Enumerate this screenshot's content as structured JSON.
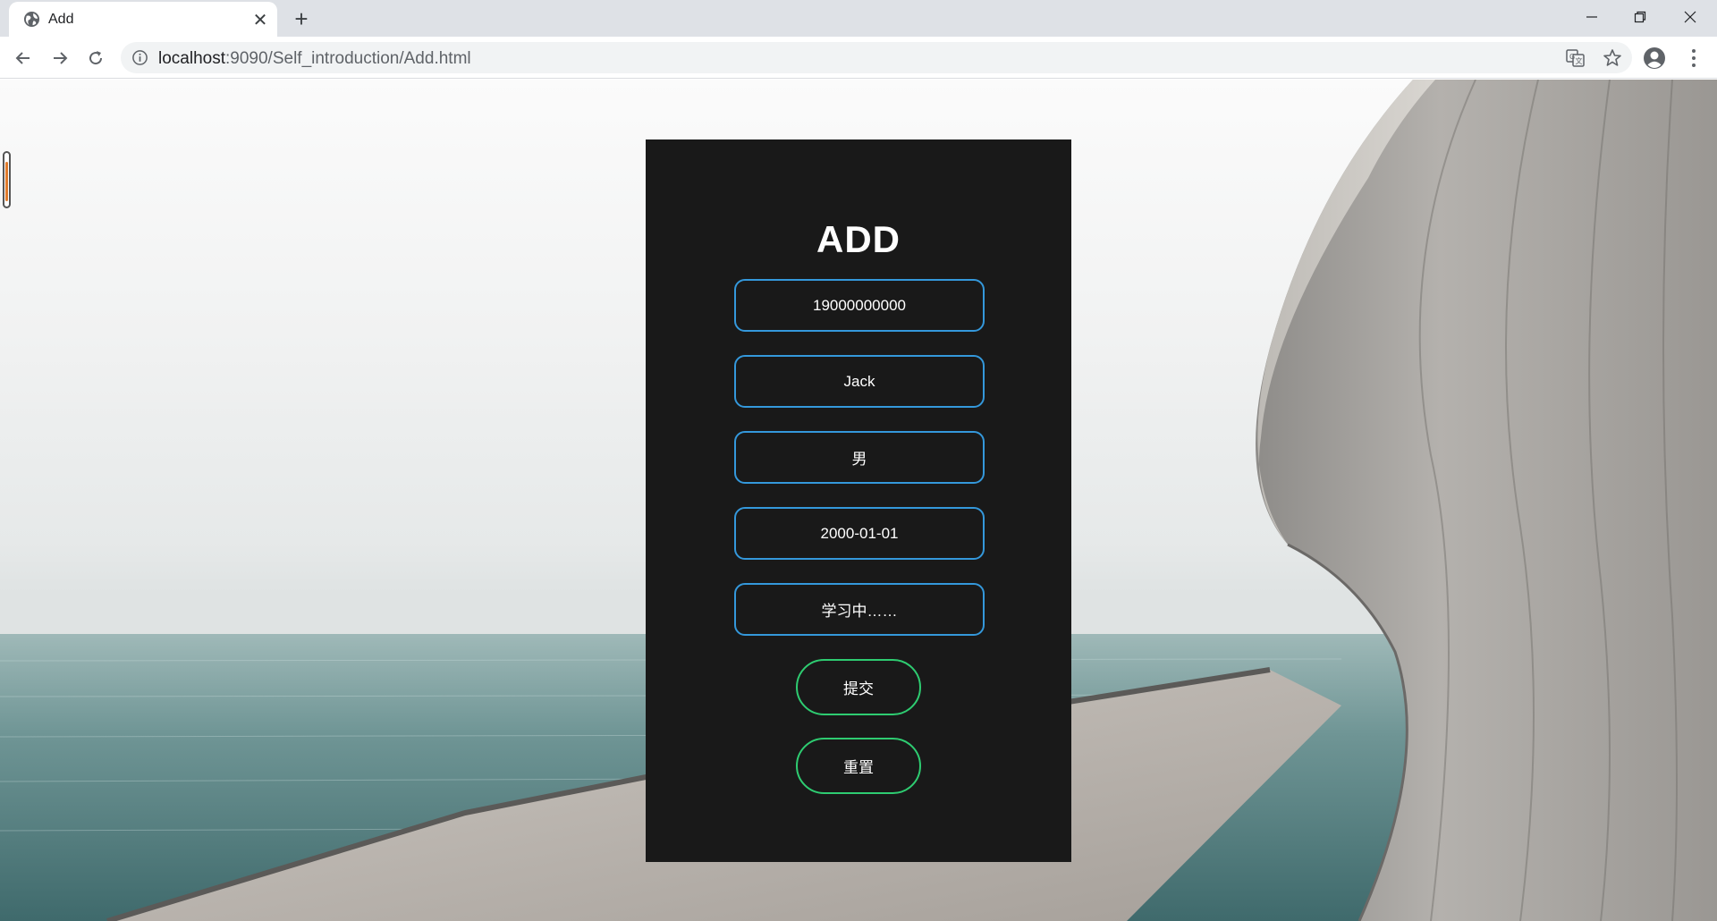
{
  "browser": {
    "tab": {
      "title": "Add",
      "close_label": "✕"
    },
    "new_tab_label": "+",
    "address": {
      "host": "localhost",
      "path": ":9090/Self_introduction/Add.html"
    }
  },
  "page": {
    "title": "ADD",
    "fields": [
      {
        "name": "phone",
        "value": "19000000000"
      },
      {
        "name": "name",
        "value": "Jack"
      },
      {
        "name": "gender",
        "value": "男"
      },
      {
        "name": "birthday",
        "value": "2000-01-01"
      },
      {
        "name": "status",
        "value": "学习中……"
      }
    ],
    "submit_label": "提交",
    "reset_label": "重置"
  },
  "colors": {
    "field_border": "#3498db",
    "button_border": "#2ecc71",
    "card_bg": "#191919"
  },
  "icons": [
    "globe-icon",
    "close-icon",
    "plus-icon",
    "back-arrow-icon",
    "forward-arrow-icon",
    "reload-icon",
    "info-icon",
    "translate-icon",
    "star-icon",
    "profile-icon",
    "kebab-menu-icon",
    "minimize-icon",
    "restore-icon"
  ]
}
